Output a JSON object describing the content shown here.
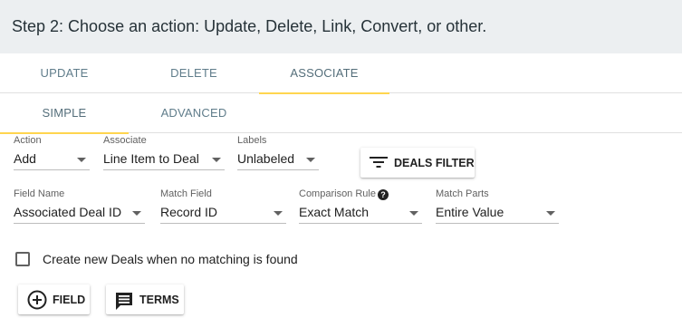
{
  "header": {
    "title": "Step 2: Choose an action: Update, Delete, Link, Convert, or other."
  },
  "tabs": [
    {
      "label": "UPDATE",
      "active": false
    },
    {
      "label": "DELETE",
      "active": false
    },
    {
      "label": "ASSOCIATE",
      "active": true
    }
  ],
  "subtabs": [
    {
      "label": "SIMPLE",
      "active": true
    },
    {
      "label": "ADVANCED",
      "active": false
    }
  ],
  "row1": {
    "action": {
      "label": "Action",
      "value": "Add"
    },
    "associate": {
      "label": "Associate",
      "value": "Line Item to Deal"
    },
    "labels": {
      "label": "Labels",
      "value": "Unlabeled"
    },
    "deals_filter": {
      "label": "DEALS FILTER",
      "icon": "filter-icon"
    }
  },
  "row2": {
    "field_name": {
      "label": "Field Name",
      "value": "Associated Deal ID"
    },
    "match_field": {
      "label": "Match Field",
      "value": "Record ID"
    },
    "comparison_rule": {
      "label": "Comparison Rule",
      "value": "Exact Match",
      "help_icon": "?"
    },
    "match_parts": {
      "label": "Match Parts",
      "value": "Entire Value"
    }
  },
  "create_new": {
    "label": "Create new Deals when no matching is found",
    "checked": false
  },
  "buttons": {
    "field": {
      "label": "FIELD",
      "icon": "add-circle-icon"
    },
    "terms": {
      "label": "TERMS",
      "icon": "comment-icon"
    }
  },
  "colors": {
    "accent": "#ffd54f",
    "header_bg": "#eceff1",
    "tab_text": "#607d8b"
  }
}
